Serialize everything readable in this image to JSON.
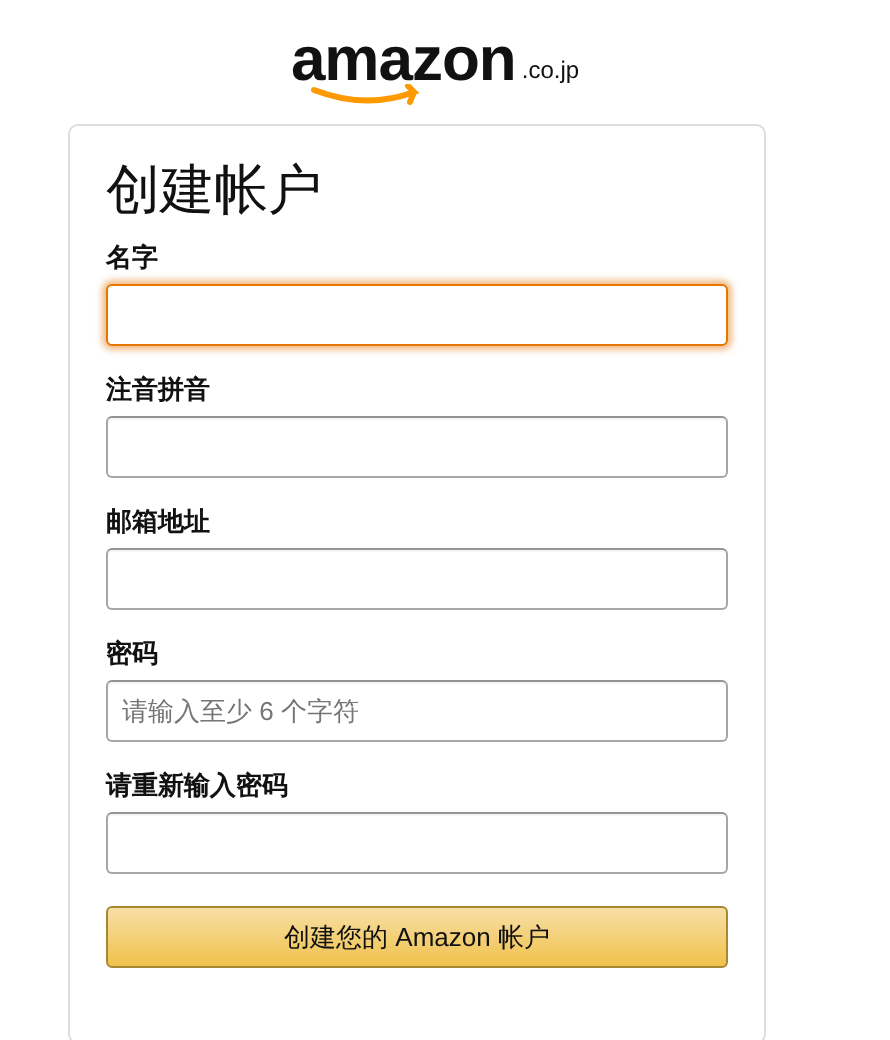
{
  "logo": {
    "wordmark": "amazon",
    "suffix": ".co.jp"
  },
  "title": "创建帐户",
  "fields": [
    {
      "label": "名字",
      "focused": true
    },
    {
      "label": "注音拼音",
      "focused": false
    },
    {
      "label": "邮箱地址",
      "focused": false
    },
    {
      "label": "密码",
      "placeholder": "请输入至少 6 个字符",
      "focused": false
    },
    {
      "label": "请重新输入密码",
      "focused": false
    }
  ],
  "submit": "创建您的 Amazon 帐户"
}
